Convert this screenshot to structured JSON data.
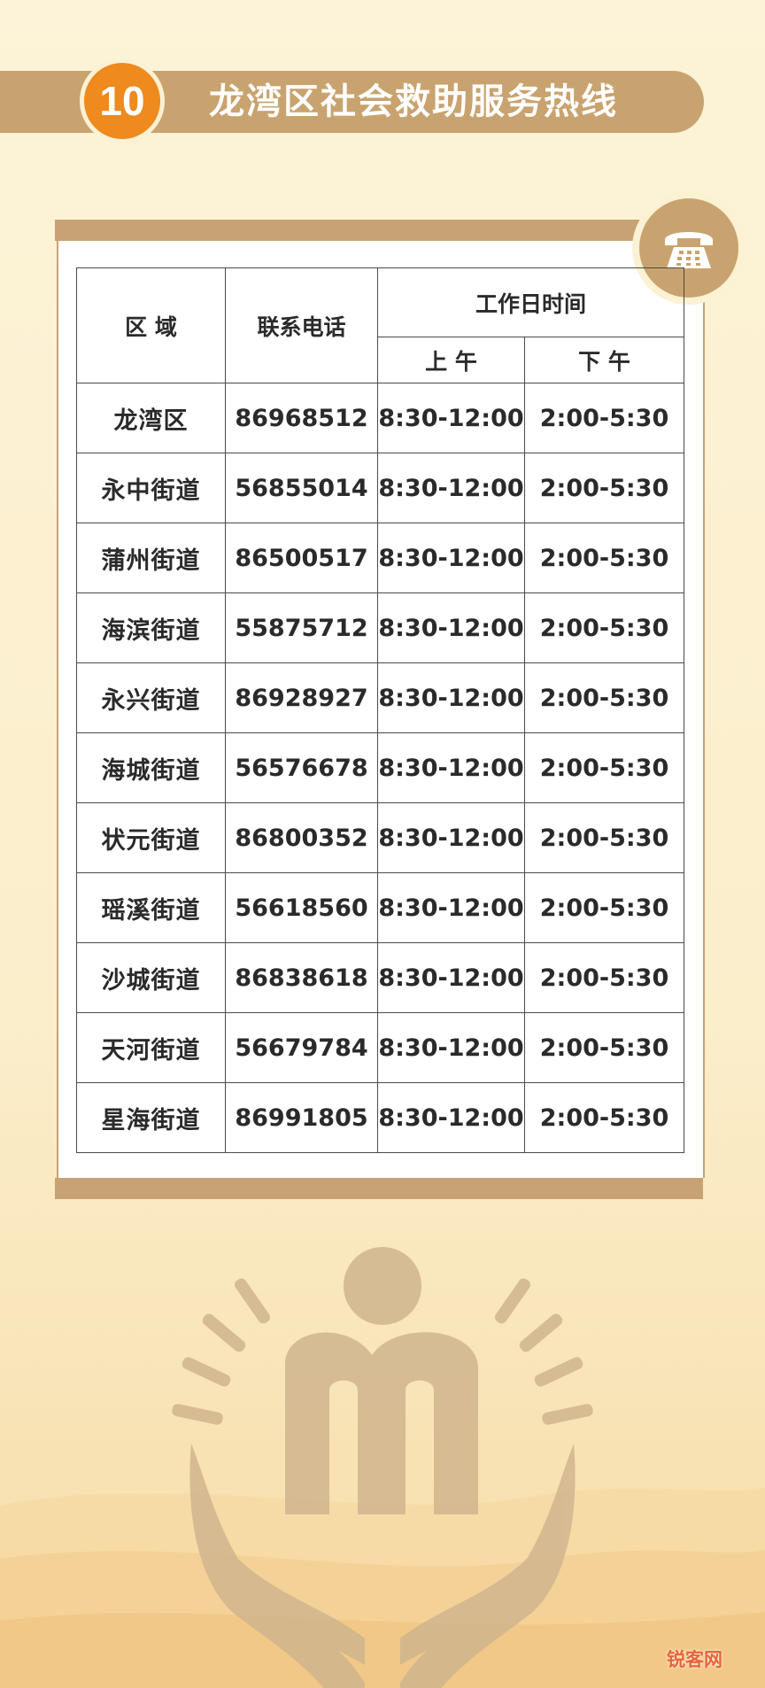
{
  "header": {
    "number": "10",
    "title": "龙湾区社会救助服务热线"
  },
  "table": {
    "headers": {
      "region": "区 域",
      "phone": "联系电话",
      "workday": "工作日时间",
      "am": "上 午",
      "pm": "下 午"
    },
    "rows": [
      {
        "region": "龙湾区",
        "phone": "86968512",
        "am": "8:30-12:00",
        "pm": "2:00-5:30"
      },
      {
        "region": "永中街道",
        "phone": "56855014",
        "am": "8:30-12:00",
        "pm": "2:00-5:30"
      },
      {
        "region": "蒲州街道",
        "phone": "86500517",
        "am": "8:30-12:00",
        "pm": "2:00-5:30"
      },
      {
        "region": "海滨街道",
        "phone": "55875712",
        "am": "8:30-12:00",
        "pm": "2:00-5:30"
      },
      {
        "region": "永兴街道",
        "phone": "86928927",
        "am": "8:30-12:00",
        "pm": "2:00-5:30"
      },
      {
        "region": "海城街道",
        "phone": "56576678",
        "am": "8:30-12:00",
        "pm": "2:00-5:30"
      },
      {
        "region": "状元街道",
        "phone": "86800352",
        "am": "8:30-12:00",
        "pm": "2:00-5:30"
      },
      {
        "region": "瑶溪街道",
        "phone": "56618560",
        "am": "8:30-12:00",
        "pm": "2:00-5:30"
      },
      {
        "region": "沙城街道",
        "phone": "86838618",
        "am": "8:30-12:00",
        "pm": "2:00-5:30"
      },
      {
        "region": "天河街道",
        "phone": "56679784",
        "am": "8:30-12:00",
        "pm": "2:00-5:30"
      },
      {
        "region": "星海街道",
        "phone": "86991805",
        "am": "8:30-12:00",
        "pm": "2:00-5:30"
      }
    ]
  },
  "icons": {
    "phone": "telephone-icon",
    "emblem": "social-assistance-emblem-icon"
  },
  "watermark": "锐客网",
  "colors": {
    "accent": "#c9a36f",
    "badge": "#ee8a1e",
    "background": "#fbf1d3"
  }
}
